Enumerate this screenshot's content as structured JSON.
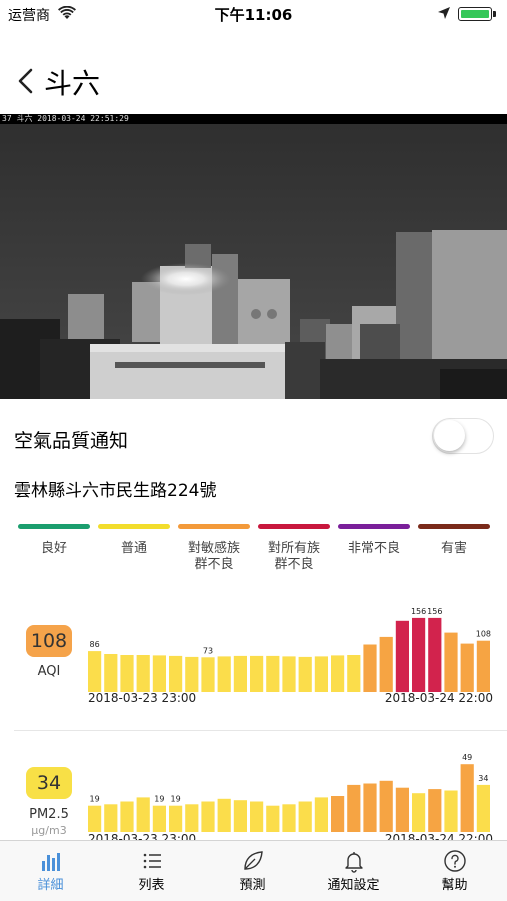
{
  "status_bar": {
    "carrier": "运营商",
    "time": "下午11:06"
  },
  "nav": {
    "title": "斗六"
  },
  "camera": {
    "timestamp": "37 斗六  2018-03-24  22:51:29"
  },
  "notification": {
    "label": "空氣品質通知",
    "enabled": false
  },
  "address": "雲林縣斗六市民生路224號",
  "legend": [
    {
      "label": "良好",
      "color": "#1b9e6e"
    },
    {
      "label": "普通",
      "color": "#f2dd2c"
    },
    {
      "label": "對敏感族\n群不良",
      "color": "#f39a3a"
    },
    {
      "label": "對所有族\n群不良",
      "color": "#c8173d"
    },
    {
      "label": "非常不良",
      "color": "#7a1f9a"
    },
    {
      "label": "有害",
      "color": "#7a2a1a"
    }
  ],
  "aqi": {
    "value": "108",
    "label": "AQI",
    "badge_color": "#f5a34a",
    "start_time": "2018-03-23 23:00",
    "end_time": "2018-03-24 22:00"
  },
  "pm25": {
    "value": "34",
    "label": "PM2.5",
    "unit": "μg/m3",
    "badge_color": "#f8e046",
    "start_time": "2018-03-23 23:00",
    "end_time": "2018-03-24 22:00"
  },
  "chart_data": [
    {
      "type": "bar",
      "title": "AQI",
      "values": [
        86,
        80,
        78,
        78,
        77,
        76,
        74,
        73,
        75,
        76,
        76,
        76,
        75,
        74,
        75,
        77,
        78,
        100,
        116,
        150,
        156,
        156,
        125,
        102,
        108
      ],
      "colors": [
        "#fbdd4b",
        "#fbdd4b",
        "#fbdd4b",
        "#fbdd4b",
        "#fbdd4b",
        "#fbdd4b",
        "#fbdd4b",
        "#fbdd4b",
        "#fbdd4b",
        "#fbdd4b",
        "#fbdd4b",
        "#fbdd4b",
        "#fbdd4b",
        "#fbdd4b",
        "#fbdd4b",
        "#fbdd4b",
        "#fbdd4b",
        "#f6a443",
        "#f6a443",
        "#d2234d",
        "#d2234d",
        "#d2234d",
        "#f6a443",
        "#f6a443",
        "#f6a443"
      ],
      "data_labels": {
        "0": "86",
        "7": "73",
        "20": "156",
        "21": "156",
        "24": "108"
      },
      "x_labels": [
        "2018-03-23 23:00",
        "2018-03-24 22:00"
      ],
      "ylim": [
        0,
        160
      ]
    },
    {
      "type": "bar",
      "title": "PM2.5",
      "values": [
        19,
        20,
        22,
        25,
        19,
        19,
        20,
        22,
        24,
        23,
        22,
        19,
        20,
        22,
        25,
        26,
        34,
        35,
        37,
        32,
        28,
        31,
        30,
        49,
        34
      ],
      "colors": [
        "#fbdd4b",
        "#fbdd4b",
        "#fbdd4b",
        "#fbdd4b",
        "#fbdd4b",
        "#fbdd4b",
        "#fbdd4b",
        "#fbdd4b",
        "#fbdd4b",
        "#fbdd4b",
        "#fbdd4b",
        "#fbdd4b",
        "#fbdd4b",
        "#fbdd4b",
        "#fbdd4b",
        "#f6a443",
        "#f6a443",
        "#f6a443",
        "#f6a443",
        "#f6a443",
        "#fbdd4b",
        "#f6a443",
        "#fbdd4b",
        "#f6a443",
        "#fbdd4b"
      ],
      "data_labels": {
        "0": "19",
        "4": "19",
        "5": "19",
        "23": "49",
        "24": "34"
      },
      "x_labels": [
        "2018-03-23 23:00",
        "2018-03-24 22:00"
      ],
      "ylim": [
        0,
        52
      ]
    }
  ],
  "tabs": [
    {
      "label": "詳細",
      "icon": "bar-chart-icon",
      "active": true
    },
    {
      "label": "列表",
      "icon": "list-icon",
      "active": false
    },
    {
      "label": "預測",
      "icon": "leaf-icon",
      "active": false
    },
    {
      "label": "通知設定",
      "icon": "bell-icon",
      "active": false
    },
    {
      "label": "幫助",
      "icon": "help-icon",
      "active": false
    }
  ]
}
